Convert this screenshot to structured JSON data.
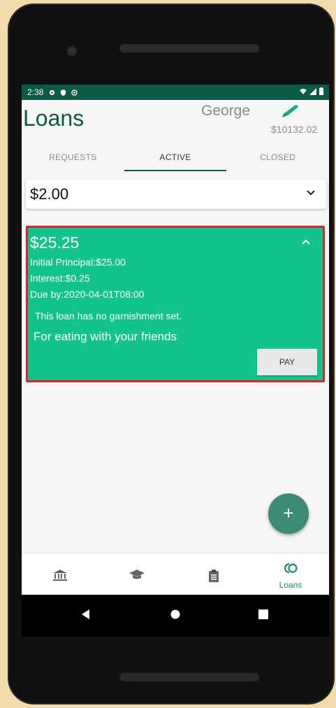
{
  "status_bar": {
    "time": "2:38",
    "left_icons": [
      "gear-icon",
      "shield-icon",
      "at-icon"
    ],
    "right_icons": [
      "wifi-icon",
      "signal-icon",
      "battery-icon"
    ]
  },
  "header": {
    "title": "Loans",
    "username": "George",
    "balance": "$10132.02",
    "edit_icon": "pencil-icon"
  },
  "tabs": [
    {
      "label": "REQUESTS",
      "active": false
    },
    {
      "label": "ACTIVE",
      "active": true
    },
    {
      "label": "CLOSED",
      "active": false
    }
  ],
  "filter": {
    "selected": "$2.00",
    "icon": "chevron-down-icon"
  },
  "loan_card": {
    "amount": "$25.25",
    "principal": "Initial Principal:$25.00",
    "interest": "Interest:$0.25",
    "due": "Due by:2020-04-01T08:00",
    "garnishment": "This loan has no garnishment set.",
    "description": "For eating with your friends",
    "pay_label": "PAY",
    "highlight_color": "#e0202a",
    "card_color": "#12c48b"
  },
  "fab": {
    "label": "+"
  },
  "bottom_nav": [
    {
      "icon": "bank-icon",
      "label": ""
    },
    {
      "icon": "graduation-cap-icon",
      "label": ""
    },
    {
      "icon": "clipboard-icon",
      "label": ""
    },
    {
      "icon": "loans-icon",
      "label": "Loans"
    }
  ],
  "system_nav": [
    "back-icon",
    "home-icon",
    "recents-icon"
  ],
  "colors": {
    "primary": "#0e5a45",
    "status_bar": "#0b5a44",
    "accent": "#3d8a75"
  }
}
